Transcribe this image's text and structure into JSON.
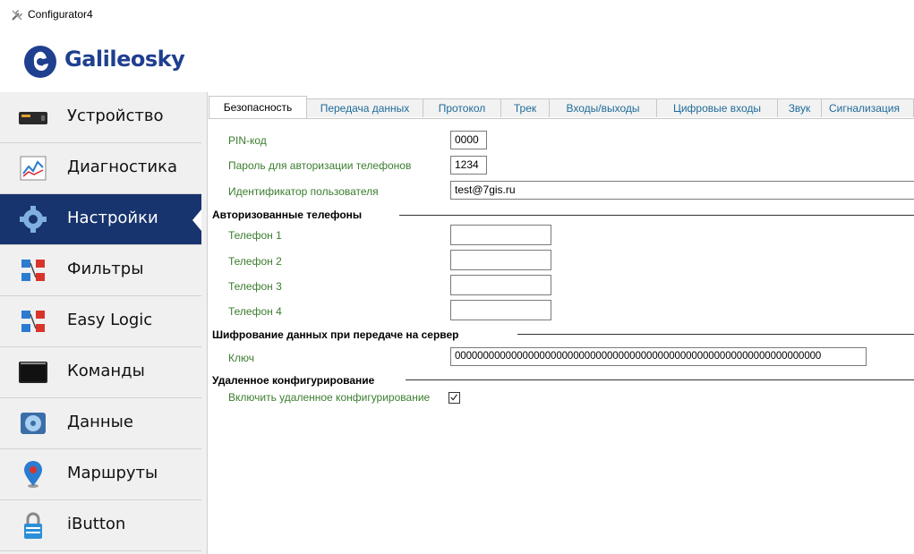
{
  "app": {
    "title": "Configurator4",
    "logo_text": "Galileosky"
  },
  "sidebar": {
    "items": [
      {
        "label": "Устройство",
        "icon": "device-icon"
      },
      {
        "label": "Диагностика",
        "icon": "diagnostics-icon"
      },
      {
        "label": "Настройки",
        "icon": "gear-icon",
        "active": true
      },
      {
        "label": "Фильтры",
        "icon": "filters-icon"
      },
      {
        "label": "Easy Logic",
        "icon": "easy-logic-icon"
      },
      {
        "label": "Команды",
        "icon": "terminal-icon"
      },
      {
        "label": "Данные",
        "icon": "data-disc-icon"
      },
      {
        "label": "Маршруты",
        "icon": "map-pin-icon"
      },
      {
        "label": "iButton",
        "icon": "lock-icon"
      }
    ]
  },
  "tabs": [
    {
      "label": "Безопасность",
      "active": true
    },
    {
      "label": "Передача данных"
    },
    {
      "label": "Протокол"
    },
    {
      "label": "Трек"
    },
    {
      "label": "Входы/выходы"
    },
    {
      "label": "Цифровые входы"
    },
    {
      "label": "Звук"
    },
    {
      "label": "Сигнализация"
    }
  ],
  "security": {
    "pin_label": "PIN-код",
    "pin_value": "0000",
    "phone_password_label": "Пароль для авторизации телефонов",
    "phone_password_value": "1234",
    "user_id_label": "Идентификатор пользователя",
    "user_id_value": "test@7gis.ru"
  },
  "authorized_phones": {
    "title": "Авторизованные телефоны",
    "phones": [
      {
        "label": "Телефон 1",
        "value": ""
      },
      {
        "label": "Телефон 2",
        "value": ""
      },
      {
        "label": "Телефон 3",
        "value": ""
      },
      {
        "label": "Телефон 4",
        "value": ""
      }
    ]
  },
  "encryption": {
    "title": "Шифрование данных при передаче на сервер",
    "key_label": "Ключ",
    "key_value": "00000000000000000000000000000000000000000000000000000000000000000"
  },
  "remote_config": {
    "title": "Удаленное конфигурирование",
    "enable_label": "Включить удаленное конфигурирование",
    "enabled": true
  },
  "colors": {
    "accent": "#17346e",
    "label_green": "#3a7d2e",
    "tab_text": "#1f6b9a",
    "logo_blue": "#1f3f8f"
  }
}
